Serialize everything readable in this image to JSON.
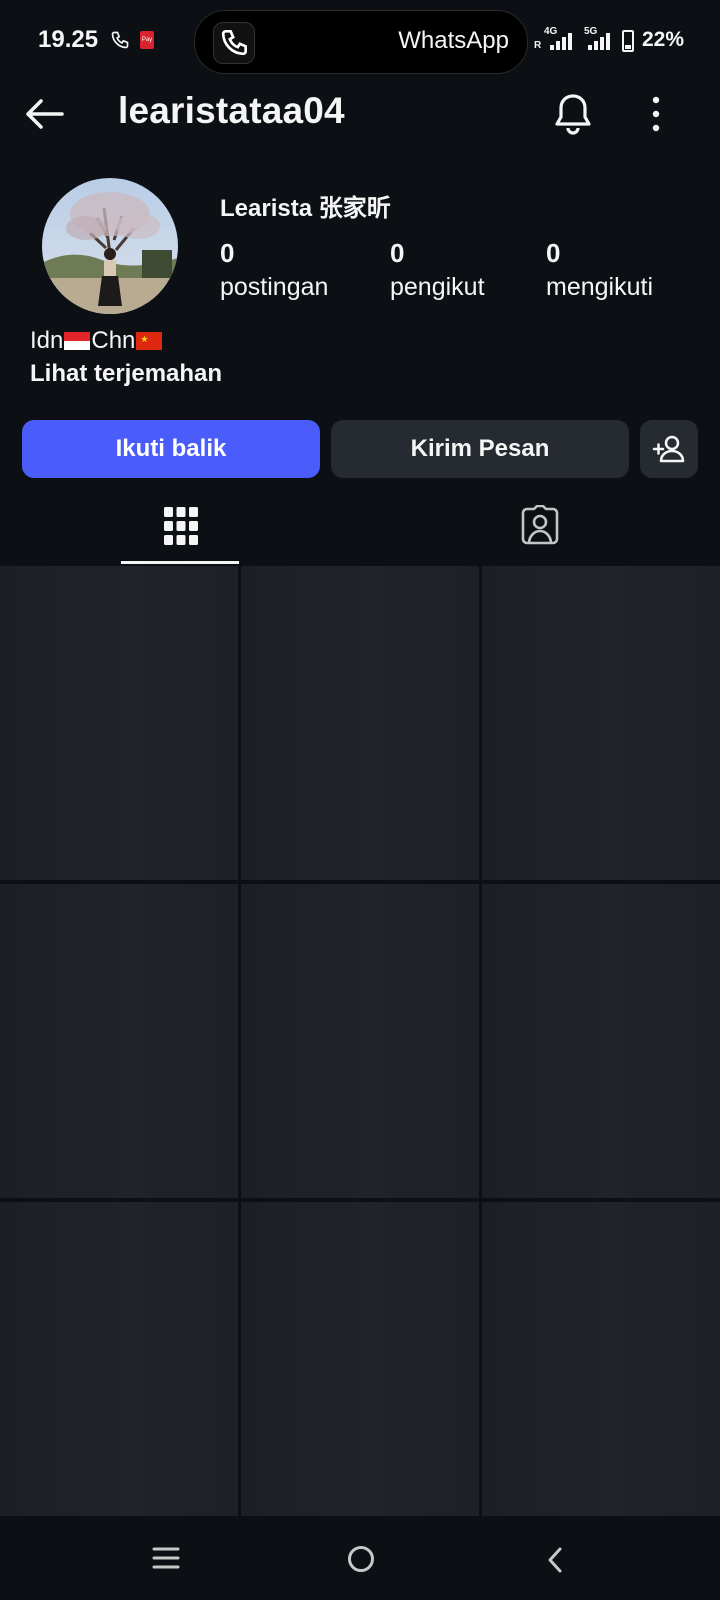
{
  "status_bar": {
    "time": "19.25",
    "pay_badge": "Pay",
    "call_app": "WhatsApp",
    "network_1": "4G",
    "network_1_sub": "R",
    "network_2": "5G",
    "battery_percent": "22%",
    "battery_level": 0.22
  },
  "header": {
    "username": "learistataa04"
  },
  "profile": {
    "display_name": "Learista 张家昕",
    "stats": [
      {
        "value": "0",
        "label": "postingan"
      },
      {
        "value": "0",
        "label": "pengikut"
      },
      {
        "value": "0",
        "label": "mengikuti"
      }
    ],
    "bio": {
      "part1": "Idn",
      "part2": "Chn"
    },
    "translate_link": "Lihat terjemahan"
  },
  "actions": {
    "follow_back": "Ikuti balik",
    "send_message": "Kirim Pesan"
  },
  "tabs": {
    "active": "posts-grid",
    "items": [
      "grid-icon",
      "tagged-icon"
    ]
  },
  "colors": {
    "background": "#0c1014",
    "primary_button": "#4a5dfa",
    "secondary_button": "#262a31"
  }
}
